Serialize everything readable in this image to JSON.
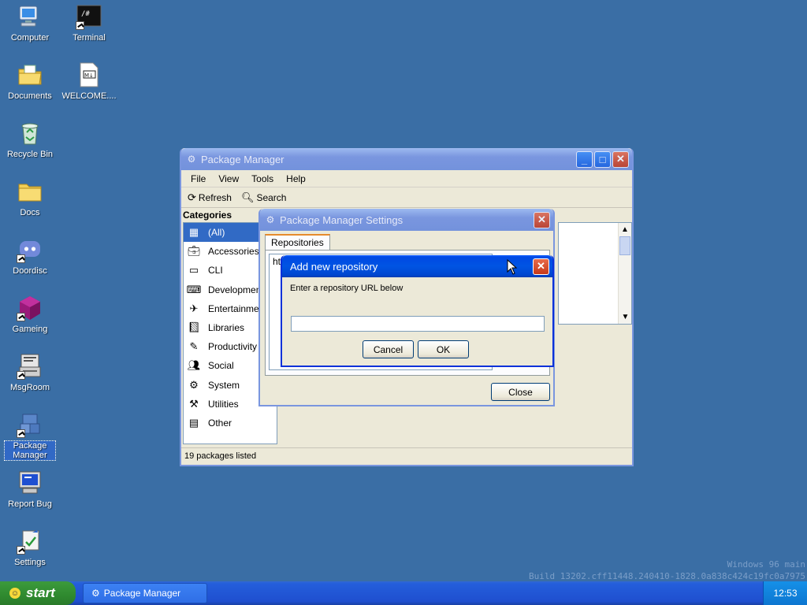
{
  "desktop": {
    "icons": [
      {
        "label": "Computer",
        "icon": "computer-icon"
      },
      {
        "label": "Terminal",
        "icon": "terminal-icon"
      },
      {
        "label": "Documents",
        "icon": "documents-folder-icon"
      },
      {
        "label": "WELCOME....",
        "icon": "markdown-file-icon"
      },
      {
        "label": "Recycle Bin",
        "icon": "recycle-bin-icon"
      },
      {
        "label": "Docs",
        "icon": "folder-icon"
      },
      {
        "label": "Doordisc",
        "icon": "discord-icon"
      },
      {
        "label": "Gameing",
        "icon": "game-cube-icon"
      },
      {
        "label": "MsgRoom",
        "icon": "chat-icon"
      },
      {
        "label": "Package Manager",
        "icon": "package-manager-icon"
      },
      {
        "label": "Report Bug",
        "icon": "report-bug-icon"
      },
      {
        "label": "Settings",
        "icon": "settings-icon"
      }
    ],
    "terminal_glyph": "/#",
    "markdown_glyph": "M↓"
  },
  "pkg_window": {
    "title": "Package Manager",
    "menu": [
      "File",
      "View",
      "Tools",
      "Help"
    ],
    "toolbar": {
      "refresh": "Refresh",
      "search": "Search"
    },
    "categories_label": "Categories",
    "categories": [
      "(All)",
      "Accessories",
      "CLI",
      "Development",
      "Entertainment",
      "Libraries",
      "Productivity",
      "Social",
      "System",
      "Utilities",
      "Other"
    ],
    "status": "19 packages listed"
  },
  "settings_window": {
    "title": "Package Manager Settings",
    "tab": "Repositories",
    "list_first_item": "htt",
    "close_label": "Close"
  },
  "repo_dialog": {
    "title": "Add new repository",
    "prompt": "Enter a repository URL below",
    "input_value": "",
    "cancel_label": "Cancel",
    "ok_label": "OK"
  },
  "taskbar": {
    "start_label": "start",
    "task_label": "Package Manager",
    "clock": "12:53"
  },
  "watermark": {
    "line1": "Windows 96 main",
    "line2": "Build 13202.cff11448.240410-1828.0a838c424c19fc0a7975"
  },
  "colors": {
    "desktop": "#3a6ea5",
    "titlebar_active": "#0054e3",
    "selection": "#316ac5",
    "taskbar": "#245edb",
    "start_green": "#2f8a2f"
  }
}
